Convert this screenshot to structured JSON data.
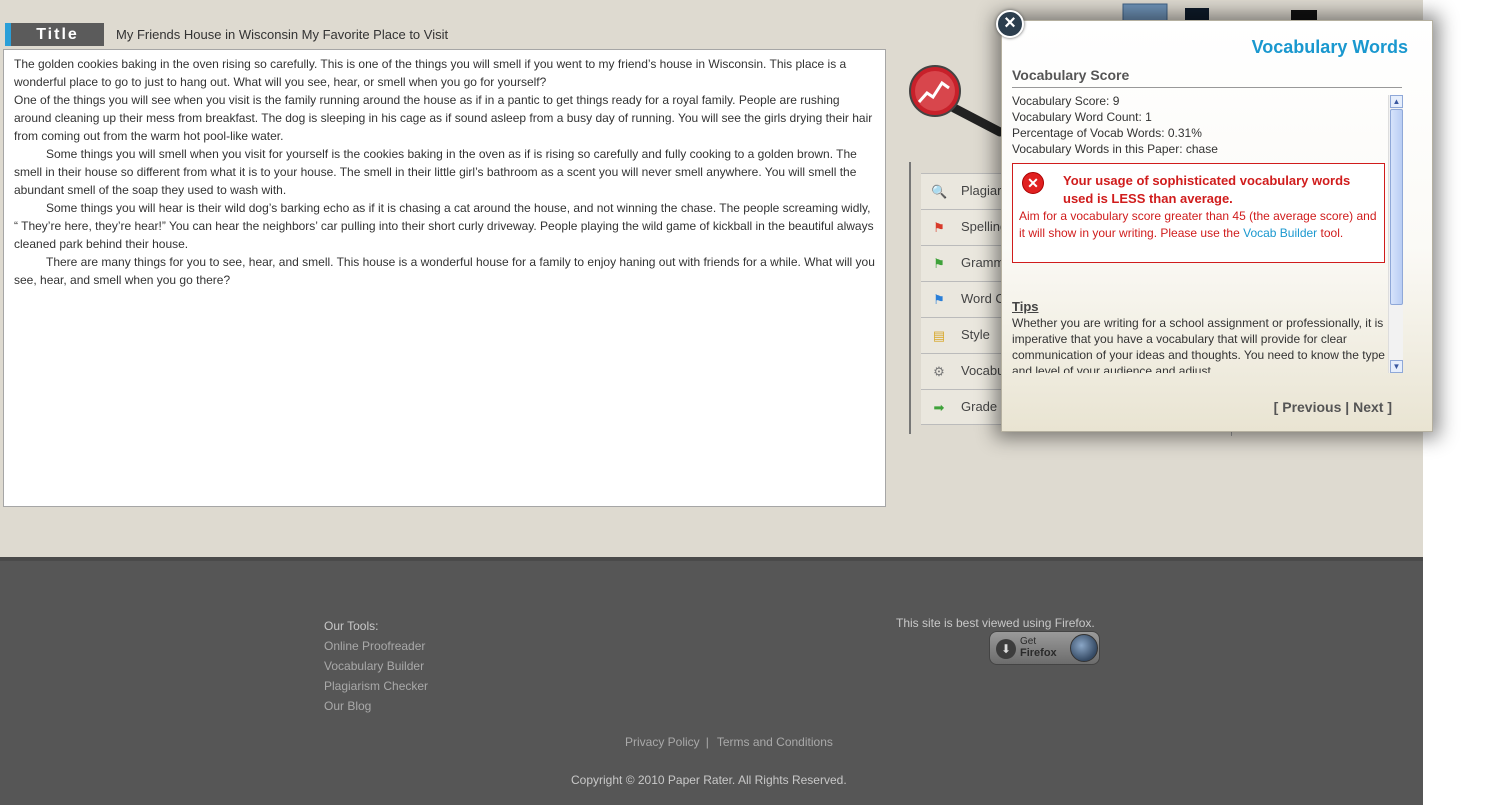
{
  "title_label": "Title",
  "paper_title": "My Friends House in Wisconsin My Favorite Place to Visit",
  "essay": {
    "paragraphs": [
      {
        "indent": false,
        "text": "The golden cookies baking in the oven rising so carefully.  This is one of the things you will smell if you went to my friend’s house in Wisconsin.  This place is a wonderful place to go to just to hang out.  What will you see, hear, or smell when you go for yourself?"
      },
      {
        "indent": false,
        "text": "One of the things you will see when you visit is the family running around the house as if in a pantic to get things ready for a royal family.  People are rushing around cleaning up their mess from  breakfast.  The dog is sleeping in his cage as if sound asleep from a busy day of running.  You will see the girls drying their hair from coming out from the warm hot pool-like water."
      },
      {
        "indent": true,
        "text": "Some things you will smell when you visit for yourself is the cookies baking in the oven as if is rising so carefully and fully cooking to a golden brown.  The smell in their house so different from what it is to your house.  The smell in their little girl’s bathroom as a scent you will never smell anywhere.  You will smell the abundant smell of the soap they used to wash with."
      },
      {
        "indent": true,
        "text": "Some things you will hear is their wild dog’s barking echo as if it is chasing a cat around the house, and not winning the chase.  The people screaming widly, “ They’re here, they’re hear!”  You can hear the neighbors’ car pulling into their short curly driveway.  People playing the wild game of kickball in the beautiful always cleaned park behind their house."
      },
      {
        "indent": true,
        "text": "There are many things for you to see, hear, and smell.  This house is a wonderful house for a family to enjoy haning out with friends for a while.  What will you see, hear, and smell when you go there?"
      }
    ]
  },
  "menu": [
    {
      "label": "Plagiar",
      "icon": "magnifier-icon",
      "glyph": "🔍",
      "color": "#5a7fb5"
    },
    {
      "label": "Spelling",
      "icon": "red-flag-icon",
      "glyph": "⚑",
      "color": "#d83a2a"
    },
    {
      "label": "Gramm",
      "icon": "green-flag-icon",
      "glyph": "⚑",
      "color": "#3fa23a"
    },
    {
      "label": "Word C",
      "icon": "blue-flag-icon",
      "glyph": "⚑",
      "color": "#2a7fd8"
    },
    {
      "label": "Style",
      "icon": "document-icon",
      "glyph": "▤",
      "color": "#d8a82a"
    },
    {
      "label": "Vocabu",
      "icon": "gear-icon",
      "glyph": "⚙",
      "color": "#777777"
    },
    {
      "label": "Grade",
      "icon": "arrow-right-icon",
      "glyph": "➡",
      "color": "#3fa23a"
    }
  ],
  "popup": {
    "close_glyph": "×",
    "title": "Vocabulary Words",
    "section": "Vocabulary Score",
    "stats": [
      "Vocabulary Score: 9",
      "Vocabulary Word Count: 1",
      "Percentage of Vocab Words: 0.31%",
      "Vocabulary Words in this Paper: chase"
    ],
    "warning": {
      "icon_glyph": "✕",
      "bold": "Your usage of sophisticated vocabulary words used is LESS than average.",
      "text": " Aim for a vocabulary score greater than 45 (the average score) and it will show in your writing. Please use the ",
      "link": "Vocab Builder",
      "tail": " tool."
    },
    "tips_title": "Tips",
    "tips_text": "Whether you are writing for a school assignment or professionally, it is imperative that you have a vocabulary that will provide for clear communication of your ideas and thoughts. You need to know the type and level of your audience and adjust",
    "pager": {
      "open": "[ ",
      "previous": "Previous",
      "sep": " | ",
      "next": "Next",
      "close": " ]"
    }
  },
  "footer": {
    "tools_heading": "Our Tools:",
    "tools": [
      "Online Proofreader",
      "Vocabulary Builder",
      "Plagiarism Checker",
      "Our Blog"
    ],
    "best_viewed": "This site is best viewed using Firefox.",
    "firefox_get": "Get",
    "firefox_name": "Firefox",
    "privacy": "Privacy Policy",
    "link_sep": "|",
    "terms": "Terms and Conditions",
    "copyright": "Copyright © 2010 Paper Rater. All Rights Reserved."
  }
}
